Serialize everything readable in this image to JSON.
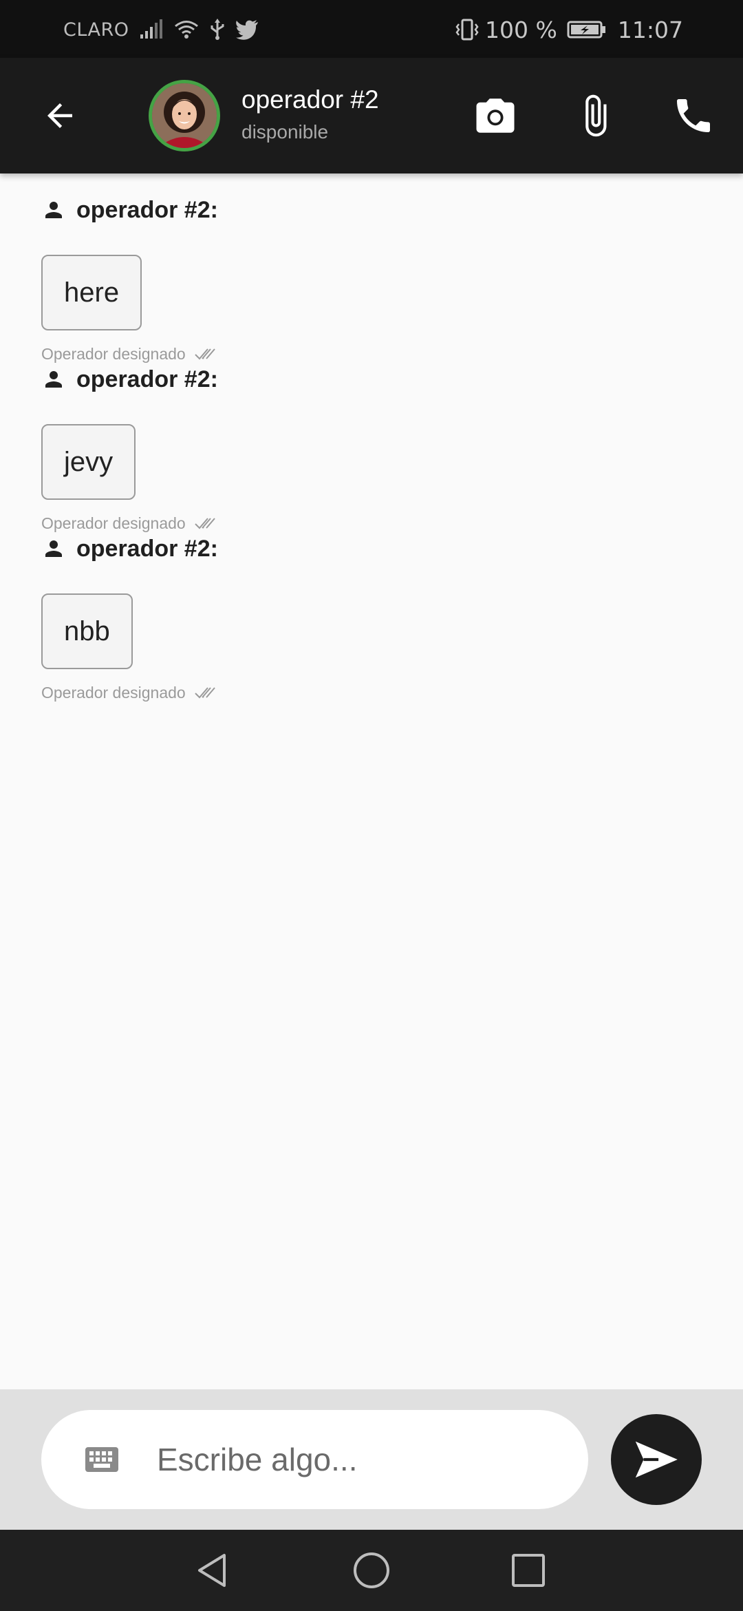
{
  "status_bar": {
    "carrier": "CLARO",
    "battery_percent": "100 %",
    "time": "11:07",
    "icons": [
      "signal-icon",
      "wifi-icon",
      "usb-icon",
      "twitter-icon",
      "vibrate-icon",
      "battery-charging-icon"
    ]
  },
  "header": {
    "back_icon": "arrow-back-icon",
    "contact_name": "operador #2",
    "contact_status": "disponible",
    "actions": [
      "camera-icon",
      "paperclip-icon",
      "phone-icon"
    ],
    "avatar_ring_color": "#45a345"
  },
  "messages": [
    {
      "sender": "operador #2:",
      "text": "here",
      "meta": "Operador designado",
      "status_icon": "double-check-icon"
    },
    {
      "sender": "operador #2:",
      "text": "jevy",
      "meta": "Operador designado",
      "status_icon": "double-check-icon"
    },
    {
      "sender": "operador #2:",
      "text": "nbb",
      "meta": "Operador designado",
      "status_icon": "double-check-icon"
    }
  ],
  "composer": {
    "placeholder": "Escribe algo...",
    "value": "",
    "keyboard_icon": "keyboard-icon",
    "send_icon": "send-icon"
  },
  "nav_bar": {
    "buttons": [
      "nav-back-icon",
      "nav-home-icon",
      "nav-recents-icon"
    ]
  },
  "colors": {
    "app_bar": "#1b1b1b",
    "status_bar": "#111111",
    "background": "#fafafa",
    "composer_bar": "#e0e0e0",
    "send_button": "#1d1d1d"
  }
}
